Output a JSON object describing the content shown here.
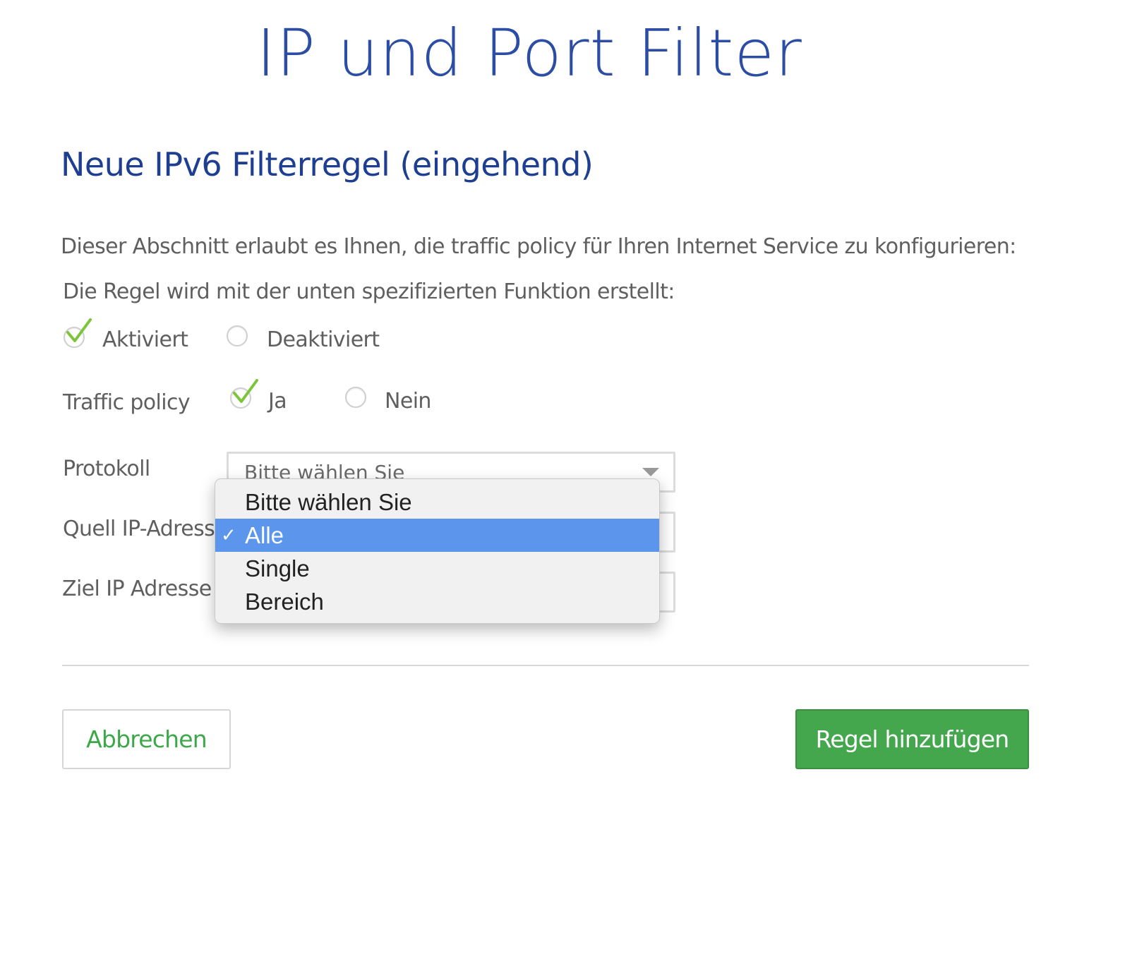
{
  "page": {
    "title": "IP und Port Filter",
    "section_title": "Neue IPv6 Filterregel (eingehend)",
    "description": "Dieser Abschnitt erlaubt es Ihnen, die traffic policy für Ihren Internet Service zu konfigurieren:",
    "rule_intro": "Die Regel wird mit der unten spezifizierten Funktion erstellt:"
  },
  "status": {
    "options": [
      {
        "label": "Aktiviert",
        "checked": true
      },
      {
        "label": "Deaktiviert",
        "checked": false
      }
    ]
  },
  "traffic_policy": {
    "label": "Traffic policy",
    "options": [
      {
        "label": "Ja",
        "checked": true
      },
      {
        "label": "Nein",
        "checked": false
      }
    ]
  },
  "fields": {
    "protokoll": {
      "label": "Protokoll",
      "value": "Bitte wählen Sie"
    },
    "quell": {
      "label": "Quell IP-Adresse"
    },
    "ziel": {
      "label": "Ziel IP Adresse"
    }
  },
  "dropdown": {
    "options": [
      "Bitte wählen Sie",
      "Alle",
      "Single",
      "Bereich"
    ],
    "selected": "Alle"
  },
  "buttons": {
    "cancel": "Abbrechen",
    "add": "Regel hinzufügen"
  },
  "colors": {
    "title_blue": "#2b4da3",
    "accent_green": "#45a74d",
    "highlight_blue": "#5b95ec"
  }
}
